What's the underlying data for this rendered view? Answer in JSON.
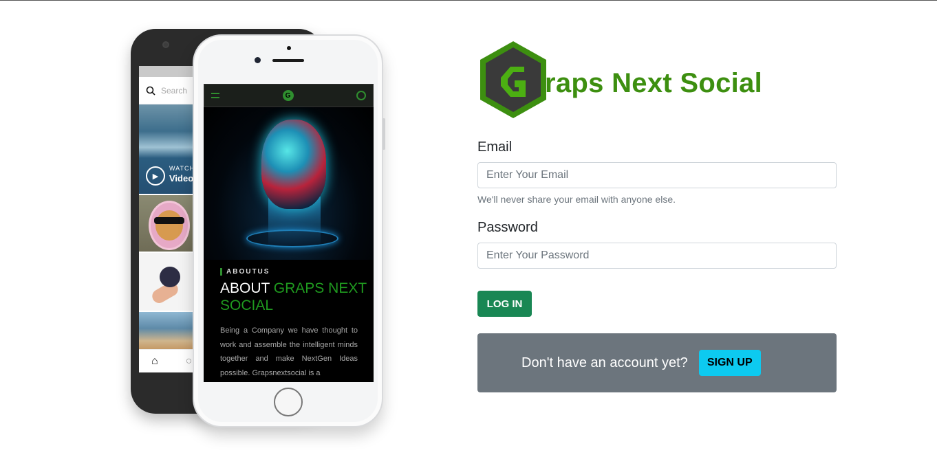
{
  "brand": {
    "logo_letter": "G",
    "name": "raps Next Social",
    "color": "#3d8f10"
  },
  "mockup": {
    "back_phone": {
      "search_placeholder": "Search",
      "watch_label": "WATCH",
      "video_label": "Video"
    },
    "front_phone": {
      "about_tag": "ABOUTUS",
      "about_title_white": "ABOUT ",
      "about_title_green": "GRAPS NEXT SOCIAL",
      "about_text": "Being a Company we have thought to work and assemble the intelligent minds together and make NextGen Ideas possible. Grapsnextsocial is a"
    }
  },
  "form": {
    "email_label": "Email",
    "email_placeholder": "Enter Your Email",
    "email_value": "",
    "email_help": "We'll never share your email with anyone else.",
    "password_label": "Password",
    "password_placeholder": "Enter Your Password",
    "password_value": "",
    "login_label": "LOG IN"
  },
  "signup": {
    "prompt": "Don't have an account yet?",
    "button_label": "SIGN UP"
  },
  "colors": {
    "brand_green": "#3d8f10",
    "login_green": "#198754",
    "signup_box": "#6c757d",
    "signup_cyan": "#0dcaf0"
  }
}
